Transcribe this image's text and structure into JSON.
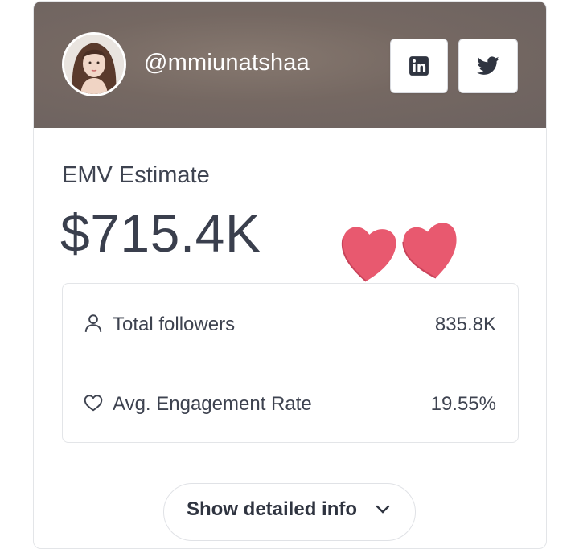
{
  "profile": {
    "handle": "@mmiunatshaa",
    "avatar_alt": "profile photo"
  },
  "social": {
    "linkedin_icon": "linkedin-icon",
    "twitter_icon": "twitter-icon"
  },
  "emv": {
    "label": "EMV Estimate",
    "value": "$715.4K"
  },
  "stats": [
    {
      "icon": "user-icon",
      "label": "Total followers",
      "value": "835.8K"
    },
    {
      "icon": "heart-outline-icon",
      "label": "Avg. Engagement Rate",
      "value": "19.55%"
    }
  ],
  "show_button": {
    "label": "Show detailed info"
  },
  "colors": {
    "header_bg": "#756862",
    "heart": "#e8596f",
    "text": "#3a3f4b"
  }
}
